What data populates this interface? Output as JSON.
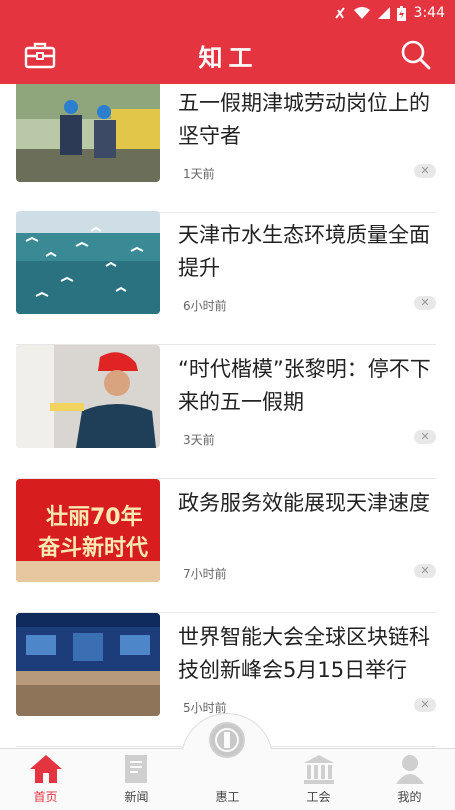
{
  "status_bar": {
    "time": "3:44"
  },
  "app_bar": {
    "title": "知工",
    "left_icon": "toolbox-icon",
    "right_icon": "search-icon"
  },
  "feed": {
    "items": [
      {
        "title": "五一假期津城劳动岗位上的坚守者",
        "time": "1天前",
        "dismiss": "✕"
      },
      {
        "title": "天津市水生态环境质量全面提升",
        "time": "6小时前",
        "dismiss": "✕"
      },
      {
        "title": "“时代楷模”张黎明：停不下来的五一假期",
        "time": "3天前",
        "dismiss": "✕"
      },
      {
        "title": "政务服务效能展现天津速度",
        "time": "7小时前",
        "dismiss": "✕",
        "thumb_text_1": "壮丽70年",
        "thumb_text_2": "奋斗新时代"
      },
      {
        "title": "世界智能大会全球区块链科技创新峰会5月15日举行",
        "time": "5小时前",
        "dismiss": "✕"
      }
    ]
  },
  "bottom_nav": {
    "items": [
      {
        "label": "首页",
        "icon": "home-icon",
        "active": true
      },
      {
        "label": "新闻",
        "icon": "news-icon",
        "active": false
      },
      {
        "label": "惠工",
        "icon": "union-emblem-icon",
        "active": false
      },
      {
        "label": "工会",
        "icon": "building-icon",
        "active": false
      },
      {
        "label": "我的",
        "icon": "person-icon",
        "active": false
      }
    ]
  },
  "colors": {
    "brand": "#e4343f",
    "text": "#222222",
    "muted": "#666666"
  }
}
